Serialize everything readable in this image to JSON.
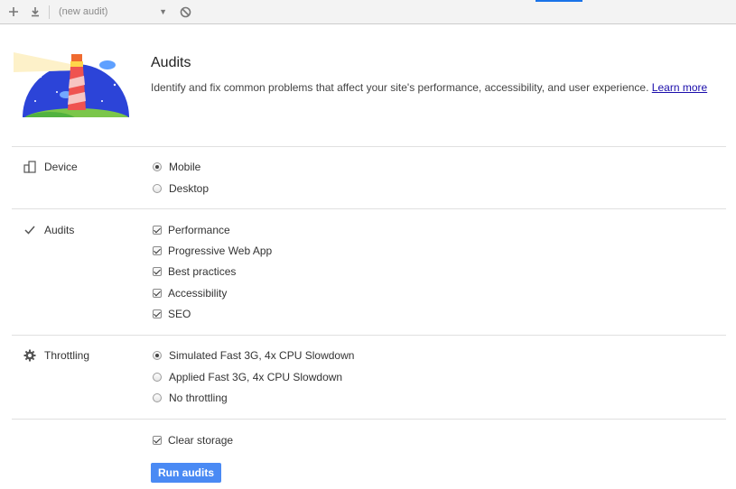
{
  "toolbar": {
    "audit_select": "(new audit)",
    "icons": [
      "plus-icon",
      "download-icon",
      "block-icon"
    ]
  },
  "hero": {
    "title": "Audits",
    "description": "Identify and fix common problems that affect your site's performance, accessibility, and user experience.",
    "link": "Learn more"
  },
  "sections": {
    "device": {
      "label": "Device",
      "options": [
        {
          "label": "Mobile",
          "checked": true
        },
        {
          "label": "Desktop",
          "checked": false
        }
      ]
    },
    "audits": {
      "label": "Audits",
      "options": [
        {
          "label": "Performance",
          "checked": true
        },
        {
          "label": "Progressive Web App",
          "checked": true
        },
        {
          "label": "Best practices",
          "checked": true
        },
        {
          "label": "Accessibility",
          "checked": true
        },
        {
          "label": "SEO",
          "checked": true
        }
      ]
    },
    "throttling": {
      "label": "Throttling",
      "options": [
        {
          "label": "Simulated Fast 3G, 4x CPU Slowdown",
          "checked": true
        },
        {
          "label": "Applied Fast 3G, 4x CPU Slowdown",
          "checked": false
        },
        {
          "label": "No throttling",
          "checked": false
        }
      ]
    },
    "storage": {
      "label": "Clear storage",
      "checked": true
    }
  },
  "run_button": "Run audits",
  "colors": {
    "primary_button": "#4a8af4",
    "link": "#1a0dab"
  }
}
